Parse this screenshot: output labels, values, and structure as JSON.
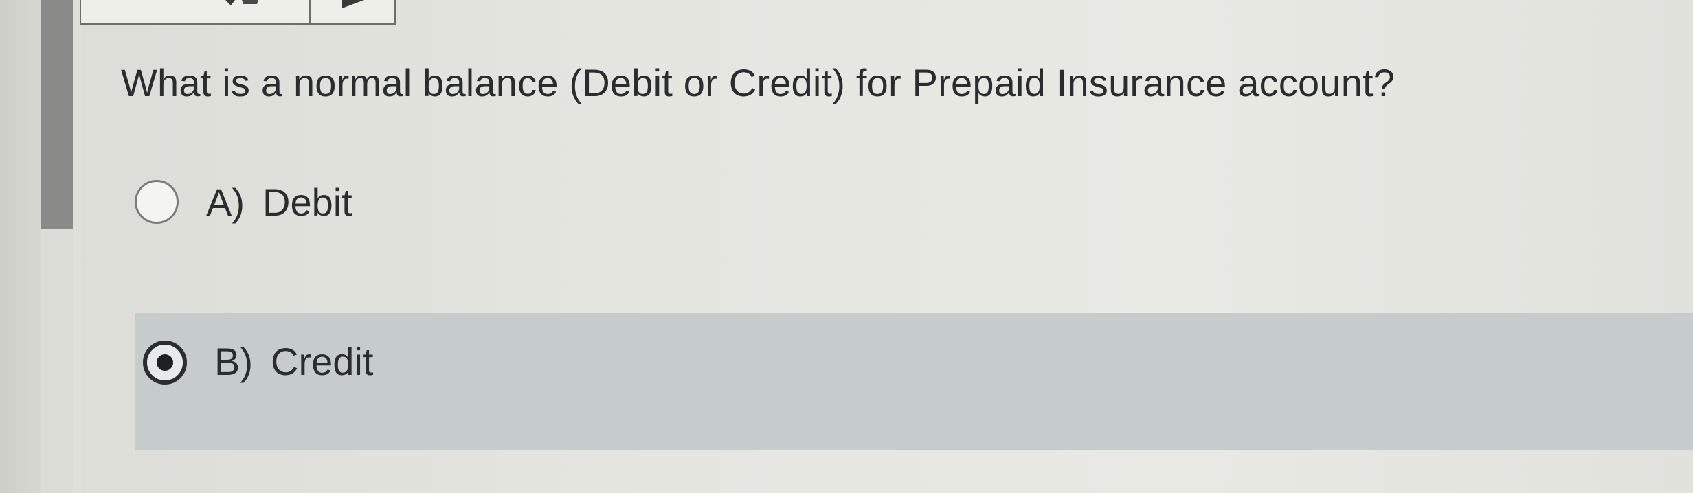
{
  "question": {
    "text": "What is a normal balance (Debit or Credit) for Prepaid Insurance account?"
  },
  "options": [
    {
      "letter": "A)",
      "text": "Debit",
      "selected": false
    },
    {
      "letter": "B)",
      "text": "Credit",
      "selected": true
    }
  ],
  "colors": {
    "selected_option_background": "#c6cccb",
    "page_background": "#e4e4df",
    "scrollbar": "#8a8a88",
    "text": "#2a2c30"
  },
  "icons": {
    "toolbar_left": "speaker-icon",
    "toolbar_right": "play-icon",
    "option_unselected": "radio-empty-icon",
    "option_selected": "radio-filled-icon"
  }
}
